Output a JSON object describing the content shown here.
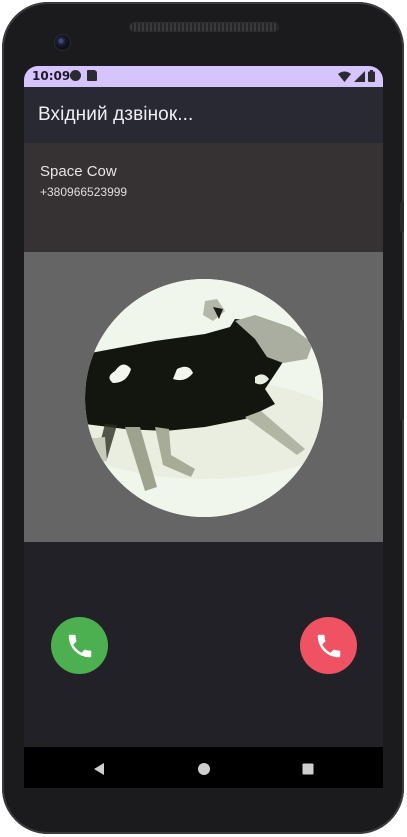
{
  "status_bar": {
    "time": "10:09",
    "left_icons": [
      "media-notification-icon",
      "sim-card-icon"
    ],
    "right_icons": [
      "wifi-icon",
      "cell-signal-icon",
      "battery-icon"
    ],
    "background_color": "#d5c4ff"
  },
  "app_bar": {
    "title": "Вхідний дзвінок..."
  },
  "caller": {
    "name": "Space Cow",
    "number": "+380966523999",
    "photo_icon": "caller-photo-cow"
  },
  "actions": {
    "accept_icon": "phone-accept-icon",
    "accept_color": "#4caf50",
    "decline_icon": "phone-decline-icon",
    "decline_color": "#ef5262"
  },
  "navigation": {
    "items": [
      "back-icon",
      "home-icon",
      "recents-icon"
    ]
  }
}
